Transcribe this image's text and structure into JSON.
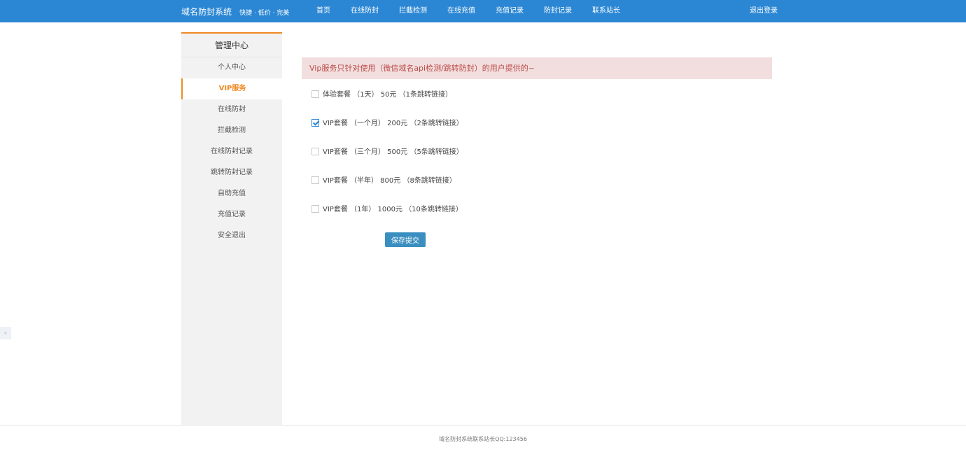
{
  "header": {
    "brand_title": "域名防封系统",
    "brand_slogan": "快捷 · 低价 · 完美",
    "nav": [
      "首页",
      "在线防封",
      "拦截检测",
      "在线充值",
      "充值记录",
      "防封记录",
      "联系站长"
    ],
    "logout": "退出登录"
  },
  "sidebar": {
    "heading": "管理中心",
    "items": [
      {
        "label": "个人中心",
        "active": false
      },
      {
        "label": "VIP服务",
        "active": true
      },
      {
        "label": "在线防封",
        "active": false
      },
      {
        "label": "拦截检测",
        "active": false
      },
      {
        "label": "在线防封记录",
        "active": false
      },
      {
        "label": "跳转防封记录",
        "active": false
      },
      {
        "label": "自助充值",
        "active": false
      },
      {
        "label": "充值记录",
        "active": false
      },
      {
        "label": "安全退出",
        "active": false
      }
    ]
  },
  "main": {
    "notice": "Vip服务只针对使用（微信域名api检测/跳转防封）的用户提供的~",
    "plans": [
      {
        "label": "体验套餐 （1天） 50元 （1条跳转链接）",
        "checked": false
      },
      {
        "label": "VIP套餐 （一个月） 200元 （2条跳转链接）",
        "checked": true
      },
      {
        "label": "VIP套餐 （三个月） 500元 （5条跳转链接）",
        "checked": false
      },
      {
        "label": "VIP套餐 （半年） 800元 （8条跳转链接）",
        "checked": false
      },
      {
        "label": "VIP套餐 （1年） 1000元 （10条跳转链接）",
        "checked": false
      }
    ],
    "submit_label": "保存提交"
  },
  "footer": {
    "text": "域名防封系统联系站长QQ:123456"
  },
  "side_tab_icon": "chevron-icon",
  "colors": {
    "header_bg": "#2b87d4",
    "accent": "#f08a24",
    "notice_bg": "#f2dede",
    "notice_text": "#b94a48",
    "button_bg": "#3a8fc0"
  }
}
